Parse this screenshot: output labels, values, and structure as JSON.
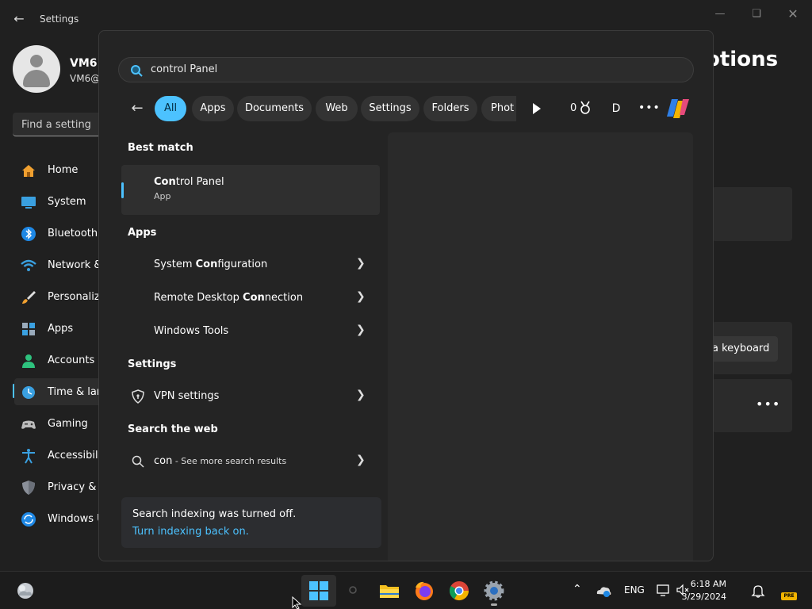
{
  "settings_window": {
    "title": "Settings",
    "user_name": "VM6",
    "user_email": "VM6@",
    "find_placeholder": "Find a setting",
    "nav": [
      {
        "label": "Home"
      },
      {
        "label": "System"
      },
      {
        "label": "Bluetooth"
      },
      {
        "label": "Network &"
      },
      {
        "label": "Personaliz"
      },
      {
        "label": "Apps"
      },
      {
        "label": "Accounts"
      },
      {
        "label": "Time & lar"
      },
      {
        "label": "Gaming"
      },
      {
        "label": "Accessibili"
      },
      {
        "label": "Privacy & s"
      },
      {
        "label": "Windows U"
      }
    ],
    "page_title_fragment": "otions",
    "button_fragment": "a keyboard"
  },
  "search_panel": {
    "query": "control Panel",
    "filters": [
      {
        "label": "All",
        "active": true
      },
      {
        "label": "Apps"
      },
      {
        "label": "Documents"
      },
      {
        "label": "Web"
      },
      {
        "label": "Settings"
      },
      {
        "label": "Folders"
      },
      {
        "label": "Phot"
      }
    ],
    "points": "0",
    "profile_initial": "D",
    "best_match_title": "Best match",
    "best_match": {
      "match": "Con",
      "rest": "trol Panel",
      "type": "App"
    },
    "apps_title": "Apps",
    "apps": [
      {
        "pre": "System ",
        "match": "Con",
        "post": "figuration"
      },
      {
        "pre": "Remote Desktop ",
        "match": "Con",
        "post": "nection"
      },
      {
        "pre": "Windows Tools",
        "match": "",
        "post": ""
      }
    ],
    "settings_title": "Settings",
    "settings_items": [
      {
        "label": "VPN settings"
      }
    ],
    "web_title": "Search the web",
    "web_item": {
      "query": "con",
      "suffix": " - See more search results"
    },
    "indexing": {
      "message": "Search indexing was turned off.",
      "link": "Turn indexing back on."
    }
  },
  "taskbar": {
    "language": "ENG",
    "time": "6:18 AM",
    "date": "3/29/2024",
    "badge": "PRE"
  },
  "colors": {
    "accent": "#4cc2ff"
  }
}
